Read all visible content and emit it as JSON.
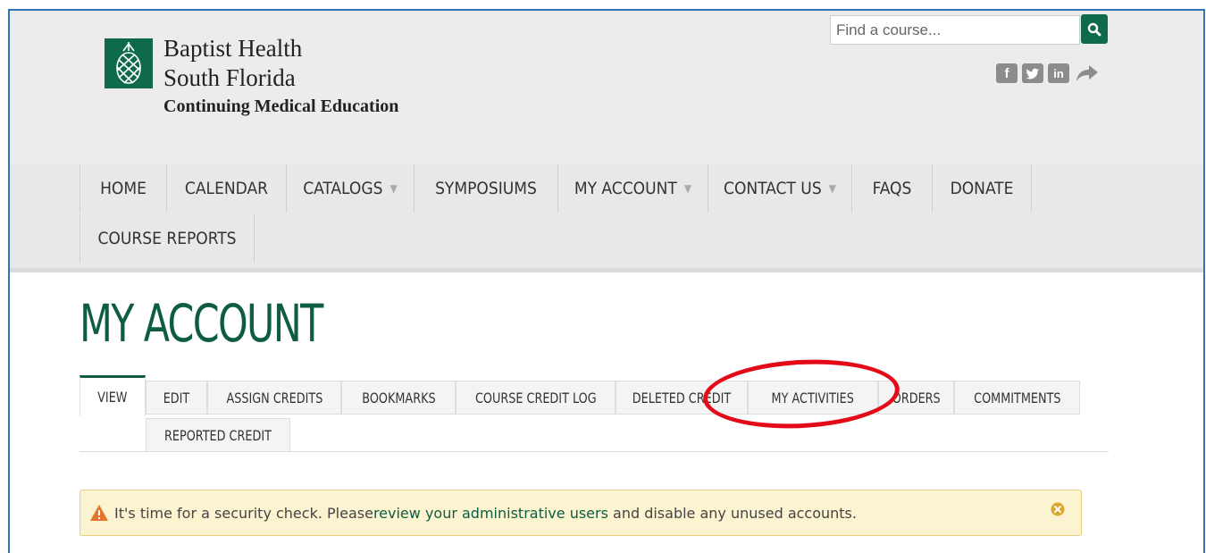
{
  "brand": {
    "line1": "Baptist Health",
    "line2": "South Florida",
    "line3": "Continuing Medical Education",
    "color": "#0f6a4d"
  },
  "search": {
    "placeholder": "Find a course...",
    "button_icon": "search-icon"
  },
  "social": [
    {
      "name": "facebook-icon",
      "glyph": "f"
    },
    {
      "name": "twitter-icon",
      "glyph": "t"
    },
    {
      "name": "linkedin-icon",
      "glyph": "in"
    },
    {
      "name": "share-icon",
      "glyph": "↪"
    }
  ],
  "nav": {
    "items": [
      {
        "label": "HOME"
      },
      {
        "label": "CALENDAR"
      },
      {
        "label": "CATALOGS"
      },
      {
        "label": "SYMPOSIUMS"
      },
      {
        "label": "MY ACCOUNT"
      },
      {
        "label": "CONTACT US"
      },
      {
        "label": "FAQS"
      },
      {
        "label": "DONATE"
      },
      {
        "label": "COURSE REPORTS"
      }
    ]
  },
  "page": {
    "title": "MY ACCOUNT"
  },
  "tabs": [
    {
      "label": "VIEW"
    },
    {
      "label": "EDIT"
    },
    {
      "label": "ASSIGN CREDITS"
    },
    {
      "label": "BOOKMARKS"
    },
    {
      "label": "COURSE CREDIT LOG"
    },
    {
      "label": "DELETED CREDIT"
    },
    {
      "label": "MY ACTIVITIES"
    },
    {
      "label": "ORDERS"
    },
    {
      "label": "COMMITMENTS"
    },
    {
      "label": "REPORTED CREDIT"
    }
  ],
  "alert": {
    "text_before": "It's time for a security check. Please ",
    "link": "review your administrative users",
    "text_after": " and disable any unused accounts."
  },
  "colors": {
    "accent": "#0f5c45",
    "annotation": "#e30b17",
    "frame": "#2f73b8"
  }
}
